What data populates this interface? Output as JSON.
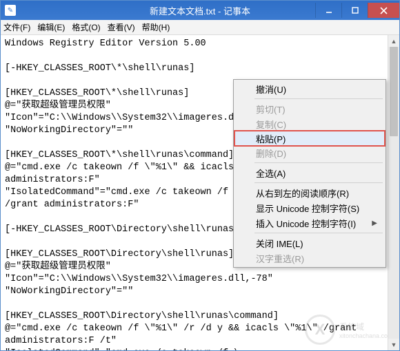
{
  "window": {
    "title": "新建文本文档.txt - 记事本"
  },
  "menubar": {
    "file": "文件(F)",
    "edit": "编辑(E)",
    "format": "格式(O)",
    "view": "查看(V)",
    "help": "帮助(H)"
  },
  "content_text": "Windows Registry Editor Version 5.00\n\n[-HKEY_CLASSES_ROOT\\*\\shell\\runas]\n\n[HKEY_CLASSES_ROOT\\*\\shell\\runas]\n@=\"获取超级管理员权限\"\n\"Icon\"=\"C:\\\\Windows\\\\System32\\\\imageres.dll,-78\"\n\"NoWorkingDirectory\"=\"\"\n\n[HKEY_CLASSES_ROOT\\*\\shell\\runas\\command]\n@=\"cmd.exe /c takeown /f \\\"%1\\\" && icacls \\\"%1\\\" /grant\nadministrators:F\"\n\"IsolatedCommand\"=\"cmd.exe /c takeown /f \\\"%1\\\" && icacls \\\"%1\\\"\n/grant administrators:F\"\n\n[-HKEY_CLASSES_ROOT\\Directory\\shell\\runas]\n\n[HKEY_CLASSES_ROOT\\Directory\\shell\\runas]\n@=\"获取超级管理员权限\"\n\"Icon\"=\"C:\\\\Windows\\\\System32\\\\imageres.dll,-78\"\n\"NoWorkingDirectory\"=\"\"\n\n[HKEY_CLASSES_ROOT\\Directory\\shell\\runas\\command]\n@=\"cmd.exe /c takeown /f \\\"%1\\\" /r /d y && icacls \\\"%1\\\" /grant\nadministrators:F /t\"\n\"IsolatedCommand\"=\"cmd.exe /c takeown /f \\\n\"%1\\\" /grant administrators:F /t\"",
  "contextmenu": {
    "undo": "撤消(U)",
    "cut": "剪切(T)",
    "copy": "复制(C)",
    "paste": "粘贴(P)",
    "delete": "删除(D)",
    "selectall": "全选(A)",
    "rtl": "从右到左的阅读顺序(R)",
    "showuni": "显示 Unicode 控制字符(S)",
    "insuni": "插入 Unicode 控制字符(I)",
    "closeime": "关闭 IME(L)",
    "reconv": "汉字重选(R)"
  },
  "watermark": {
    "glyph": "X",
    "line1": "系统域",
    "line2": "xitonchachana.co"
  }
}
